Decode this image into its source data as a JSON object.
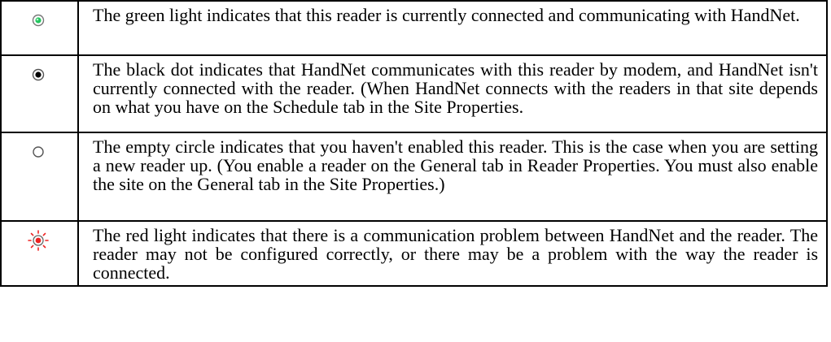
{
  "rows": [
    {
      "icon": "green-light-icon",
      "icon_color": "#22c55e",
      "text": "The green light indicates that this reader is currently connected and communicating with HandNet."
    },
    {
      "icon": "black-dot-icon",
      "icon_color": "#000000",
      "text": "The black dot indicates that HandNet communicates with this reader by modem, and HandNet isn't currently connected with the reader. (When HandNet connects with the readers in that site depends on what you have on the Schedule tab in the Site Properties."
    },
    {
      "icon": "empty-circle-icon",
      "icon_color": "#555555",
      "text": "The empty circle indicates that you haven't enabled this reader. This is the case when you are setting a new reader up. (You enable a reader on the General tab in Reader Properties. You must also enable the site on the General tab in the Site Properties.)"
    },
    {
      "icon": "red-light-icon",
      "icon_color": "#ee2222",
      "text": "The red light indicates that there is a communication problem between HandNet and the reader. The reader may not be configured correctly, or there may be a problem with the way the reader is connected."
    }
  ]
}
